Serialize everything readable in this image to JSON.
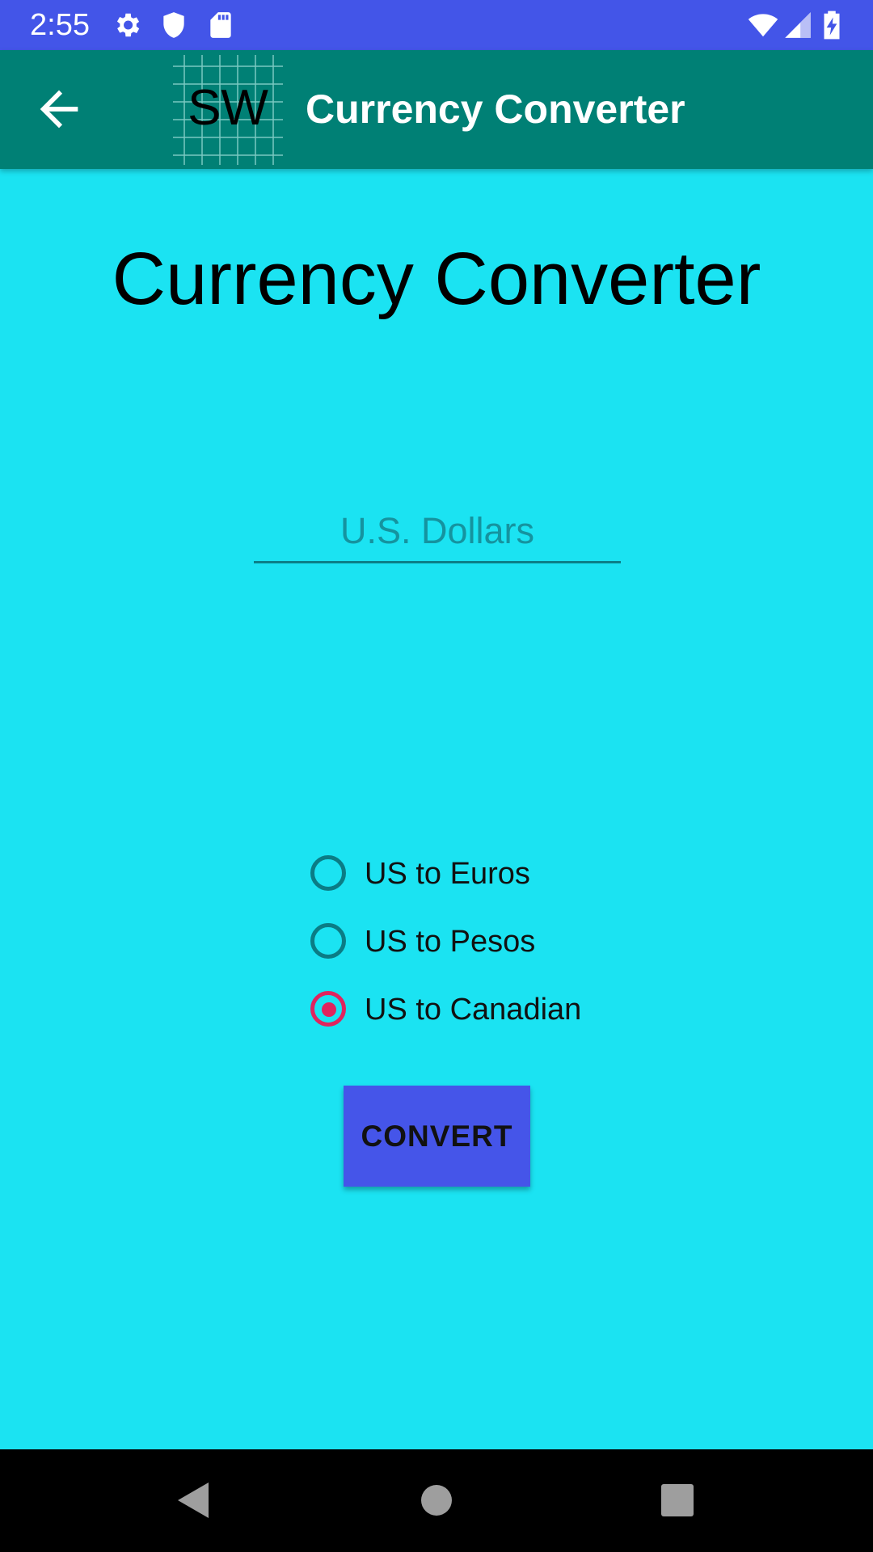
{
  "status_bar": {
    "time": "2:55",
    "left_icons": [
      "gear-icon",
      "shield-icon",
      "sd-card-icon"
    ],
    "right_icons": [
      "wifi-icon",
      "signal-icon",
      "battery-charging-icon"
    ],
    "color": "#4355e8"
  },
  "app_bar": {
    "logo_text": "SW",
    "title": "Currency Converter",
    "back_icon": "arrow-back-icon",
    "color": "#008075"
  },
  "main": {
    "heading": "Currency Converter",
    "amount_placeholder": "U.S. Dollars",
    "amount_value": "",
    "options": [
      {
        "label": "US to Euros",
        "checked": false
      },
      {
        "label": "US to Pesos",
        "checked": false
      },
      {
        "label": "US to Canadian",
        "checked": true
      }
    ],
    "convert_label": "CONVERT",
    "background": "#1be3f2",
    "accent": "#e0245e"
  },
  "nav_bar": {
    "icons": [
      "back-triangle-icon",
      "home-circle-icon",
      "recents-square-icon"
    ]
  }
}
